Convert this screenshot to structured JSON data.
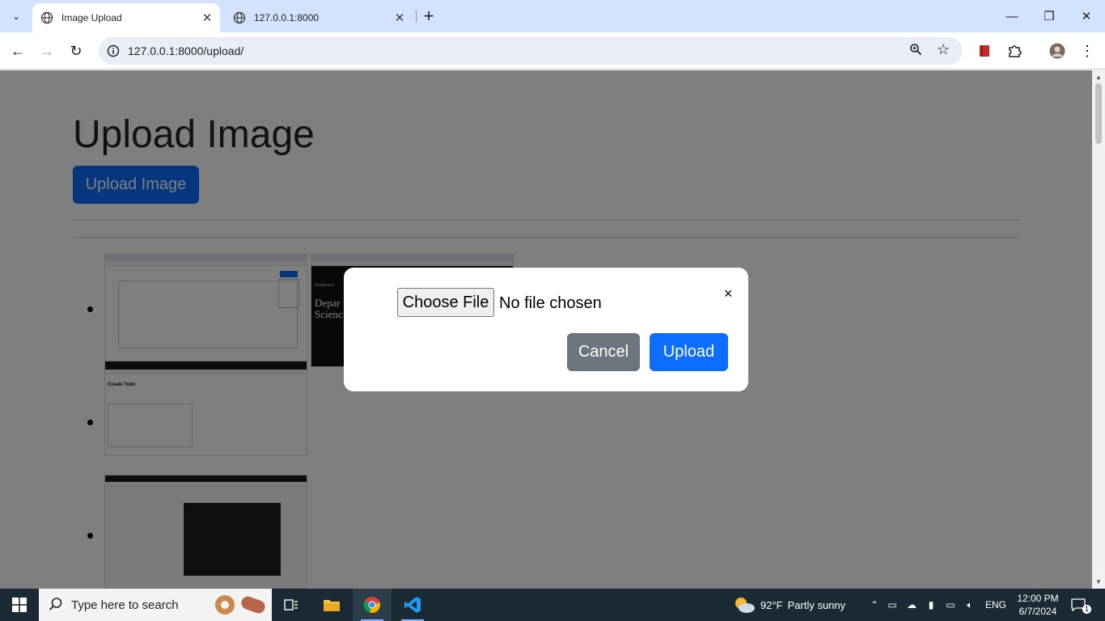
{
  "browser": {
    "tabs": [
      {
        "title": "Image Upload",
        "active": true
      },
      {
        "title": "127.0.0.1:8000",
        "active": false
      }
    ],
    "url": "127.0.0.1:8000/upload/"
  },
  "page": {
    "title": "Upload Image",
    "upload_button_label": "Upload Image"
  },
  "modal": {
    "choose_file_label": "Choose File",
    "file_status": "No file chosen",
    "close_glyph": "×",
    "cancel_label": "Cancel",
    "upload_label": "Upload"
  },
  "gallery": {
    "thumb1_caption": "Create Todo",
    "thumb2_text1": "Academics",
    "thumb2_text2": "Depar",
    "thumb2_text3": "Scienc"
  },
  "taskbar": {
    "search_placeholder": "Type here to search",
    "weather_temp": "92°F",
    "weather_desc": "Partly sunny",
    "language": "ENG",
    "time": "12:00 PM",
    "date": "6/7/2024",
    "notification_count": "1"
  },
  "colors": {
    "primary": "#0d6efd",
    "secondary": "#6c757d",
    "chrome_tab_bar": "#d3e3fd",
    "taskbar": "#1a2b36"
  }
}
